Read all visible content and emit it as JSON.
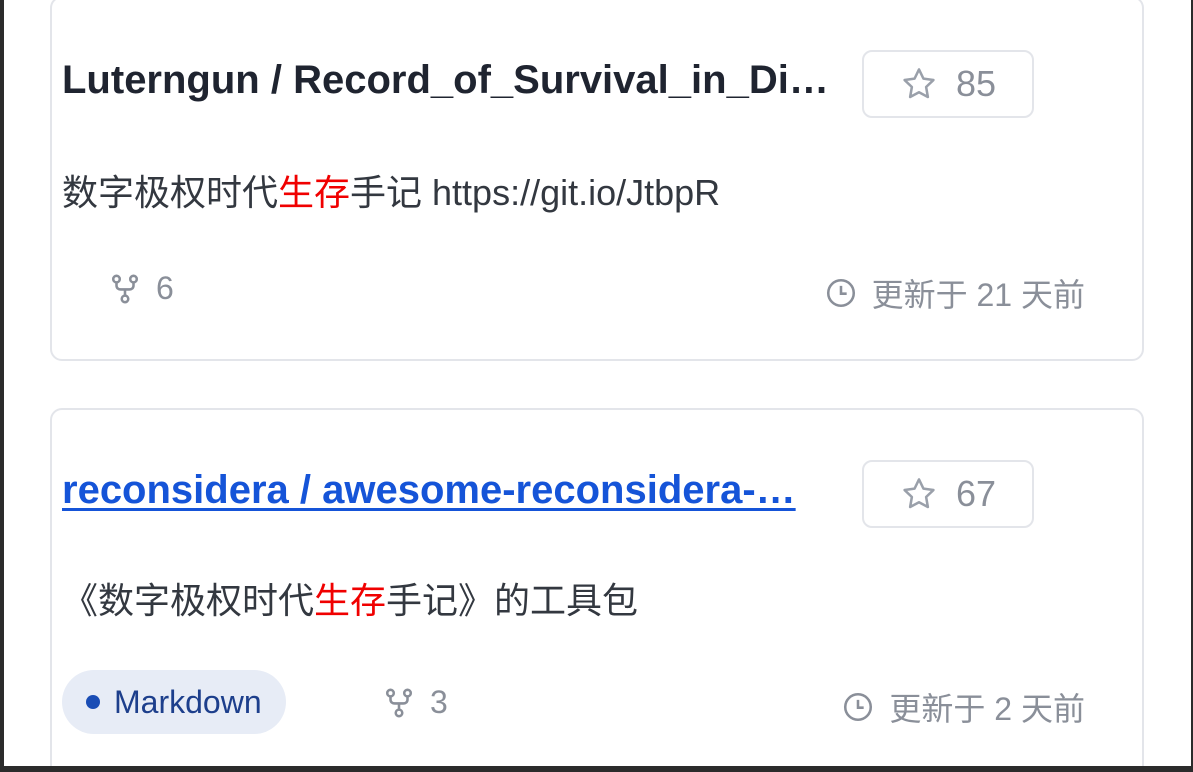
{
  "repos": [
    {
      "title": "Luterngun / Record_of_Survival_in_Di…",
      "stars": "85",
      "desc_before": "数字极权时代",
      "desc_highlight": "生存",
      "desc_after": "手记 https://git.io/JtbpR",
      "forks": "6",
      "updated": "更新于 21 天前"
    },
    {
      "title": "reconsidera / awesome-reconsidera-…",
      "stars": "67",
      "desc_before": "《数字极权时代",
      "desc_highlight": "生存",
      "desc_after": "手记》的工具包",
      "language": "Markdown",
      "forks": "3",
      "updated": "更新于 2 天前"
    }
  ],
  "icons": {
    "star": "star-icon",
    "fork": "fork-icon",
    "clock": "clock-icon"
  },
  "colors": {
    "highlight": "#f00000",
    "link": "#1554d8",
    "language_dot": "#1a4db5"
  }
}
